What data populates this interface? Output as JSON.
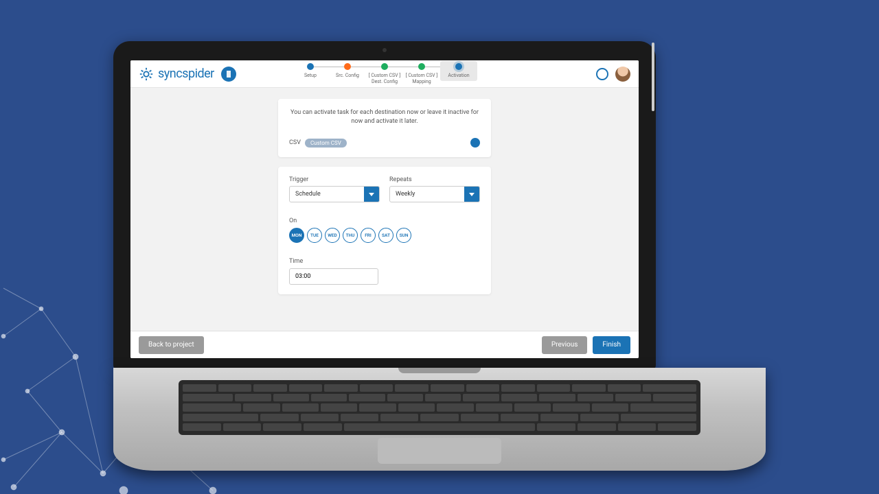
{
  "brand": {
    "name": "syncspider"
  },
  "stepper": {
    "steps": [
      {
        "label": "Setup",
        "color": "blue"
      },
      {
        "label": "Src. Config",
        "color": "orange"
      },
      {
        "label": "[ Custom CSV ]\nDest. Config",
        "color": "green"
      },
      {
        "label": "[ Custom CSV ]\nMapping",
        "color": "green"
      },
      {
        "label": "Activation",
        "color": "blue",
        "active": true
      }
    ]
  },
  "activation": {
    "info": "You can activate task for each destination now or leave it inactive for now and activate it later.",
    "dest_label": "CSV",
    "dest_pill": "Custom CSV"
  },
  "trigger": {
    "label": "Trigger",
    "value": "Schedule"
  },
  "repeats": {
    "label": "Repeats",
    "value": "Weekly"
  },
  "on": {
    "label": "On",
    "days": [
      "MON",
      "TUE",
      "WED",
      "THU",
      "FRI",
      "SAT",
      "SUN"
    ],
    "selected": "MON"
  },
  "time": {
    "label": "Time",
    "value": "03:00"
  },
  "footer": {
    "back": "Back to project",
    "previous": "Previous",
    "finish": "Finish"
  }
}
